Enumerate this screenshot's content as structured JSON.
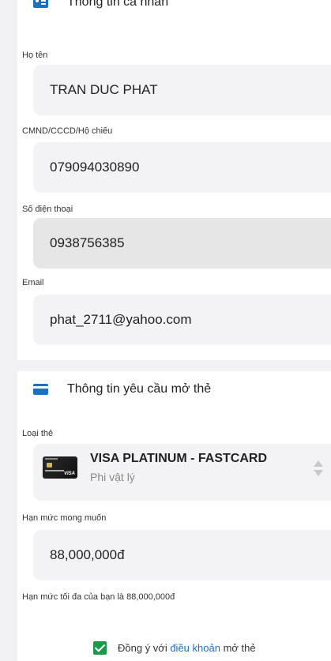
{
  "personal": {
    "section_icon": "contact-card-icon",
    "section_title": "Thông tin cá nhân",
    "fields": [
      {
        "label": "Họ tên",
        "value": "TRAN DUC PHAT"
      },
      {
        "label": "CMND/CCCD/Hộ chiếu",
        "value": "079094030890"
      },
      {
        "label": "Số điện thoại",
        "value": "0938756385"
      },
      {
        "label": "Email",
        "value": "phat_2711@yahoo.com"
      }
    ]
  },
  "request": {
    "section_icon": "credit-card-icon",
    "section_title": "Thông tin yêu cầu mở thẻ",
    "card_type_label": "Loại thẻ",
    "card_type_name": "VISA PLATINUM - FASTCARD",
    "card_type_sub": "Phi vật lý",
    "limit_label": "Hạn mức mong muốn",
    "limit_value": "88,000,000đ",
    "limit_hint": "Hạn mức tối đa của bạn là 88,000,000đ"
  },
  "agreement": {
    "checked": true,
    "text_before": "Đồng ý với ",
    "link_text": "điều khoản",
    "text_after": " mở thẻ"
  },
  "colors": {
    "accent": "#1d6fc0",
    "checkbox": "#1a9a48"
  }
}
